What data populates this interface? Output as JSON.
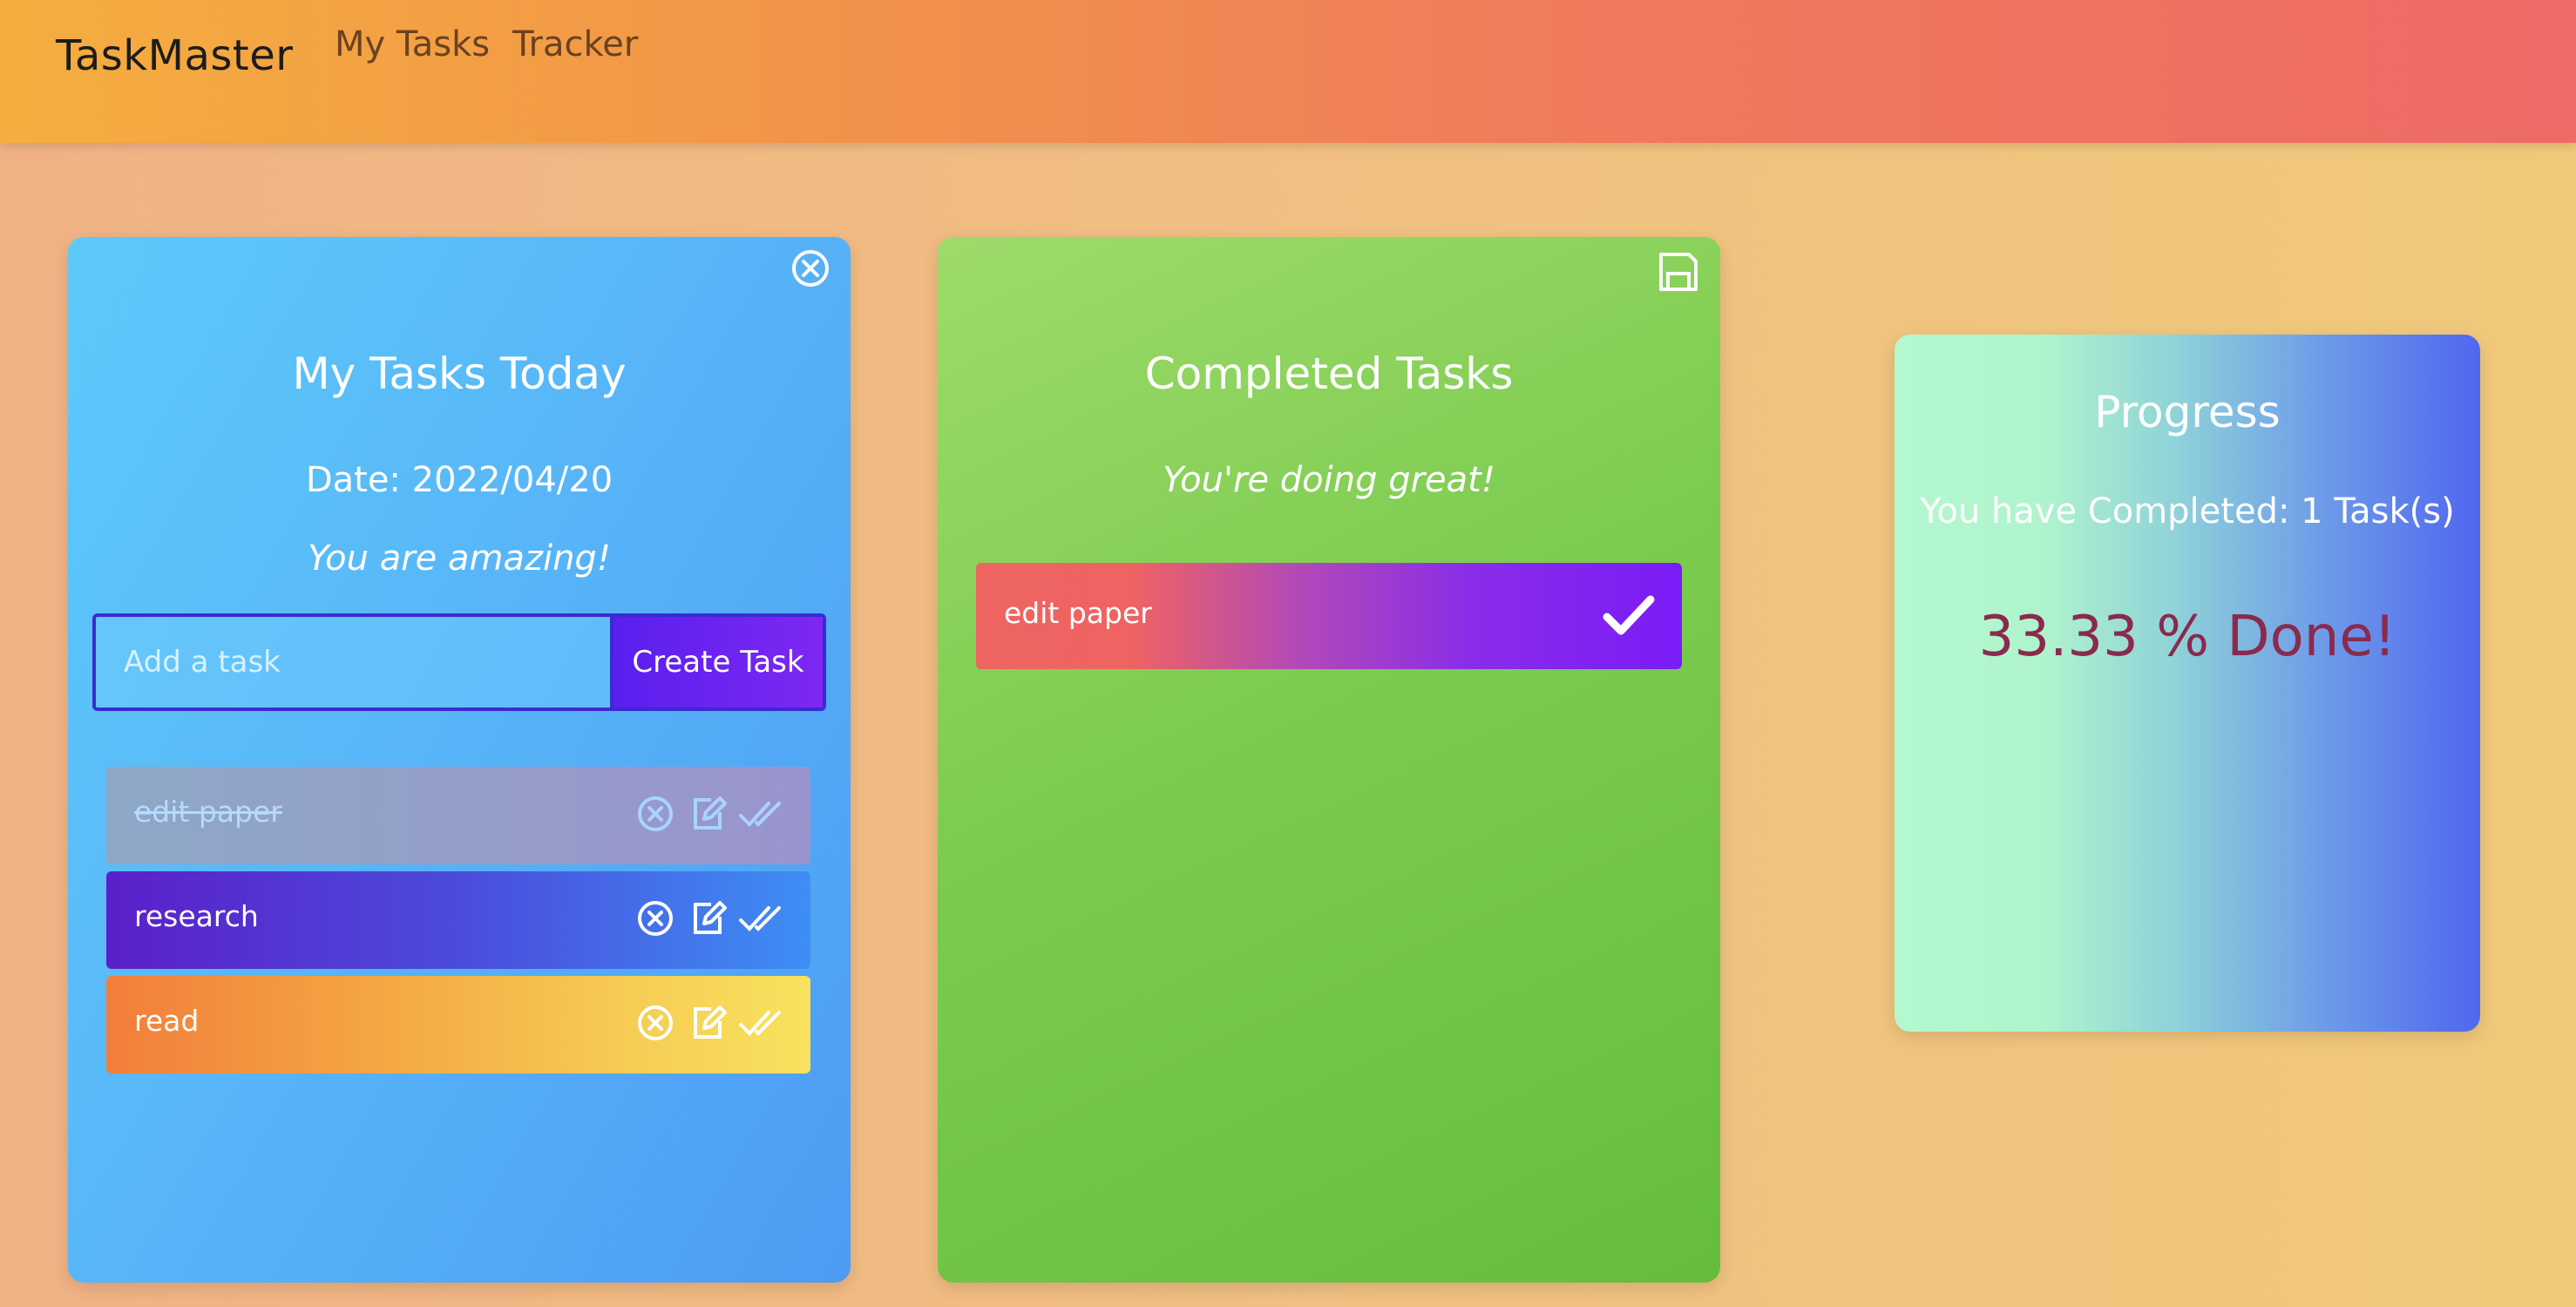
{
  "navbar": {
    "brand": "TaskMaster",
    "links": [
      "My Tasks",
      "Tracker"
    ]
  },
  "tasks_card": {
    "title": "My Tasks Today",
    "date": "Date: 2022/04/20",
    "motto": "You are amazing!",
    "input_placeholder": "Add a task",
    "create_label": "Create Task",
    "items": [
      {
        "label": "edit paper",
        "completed": true
      },
      {
        "label": "research",
        "completed": false
      },
      {
        "label": "read",
        "completed": false
      }
    ]
  },
  "completed_card": {
    "title": "Completed Tasks",
    "motto": "You're doing great!",
    "items": [
      {
        "label": "edit paper"
      }
    ]
  },
  "progress_card": {
    "title": "Progress",
    "completed_text": "You have Completed: 1 Task(s)",
    "percent_text": "33.33 % Done!"
  },
  "colors": {
    "nav_start": "#f4ae3f",
    "nav_end": "#ed6a66",
    "tasks_card": "#58b6f8",
    "completed_card": "#7ccb4f",
    "progress_text": "#8a2a4e",
    "create_button": "#5a1fee"
  }
}
